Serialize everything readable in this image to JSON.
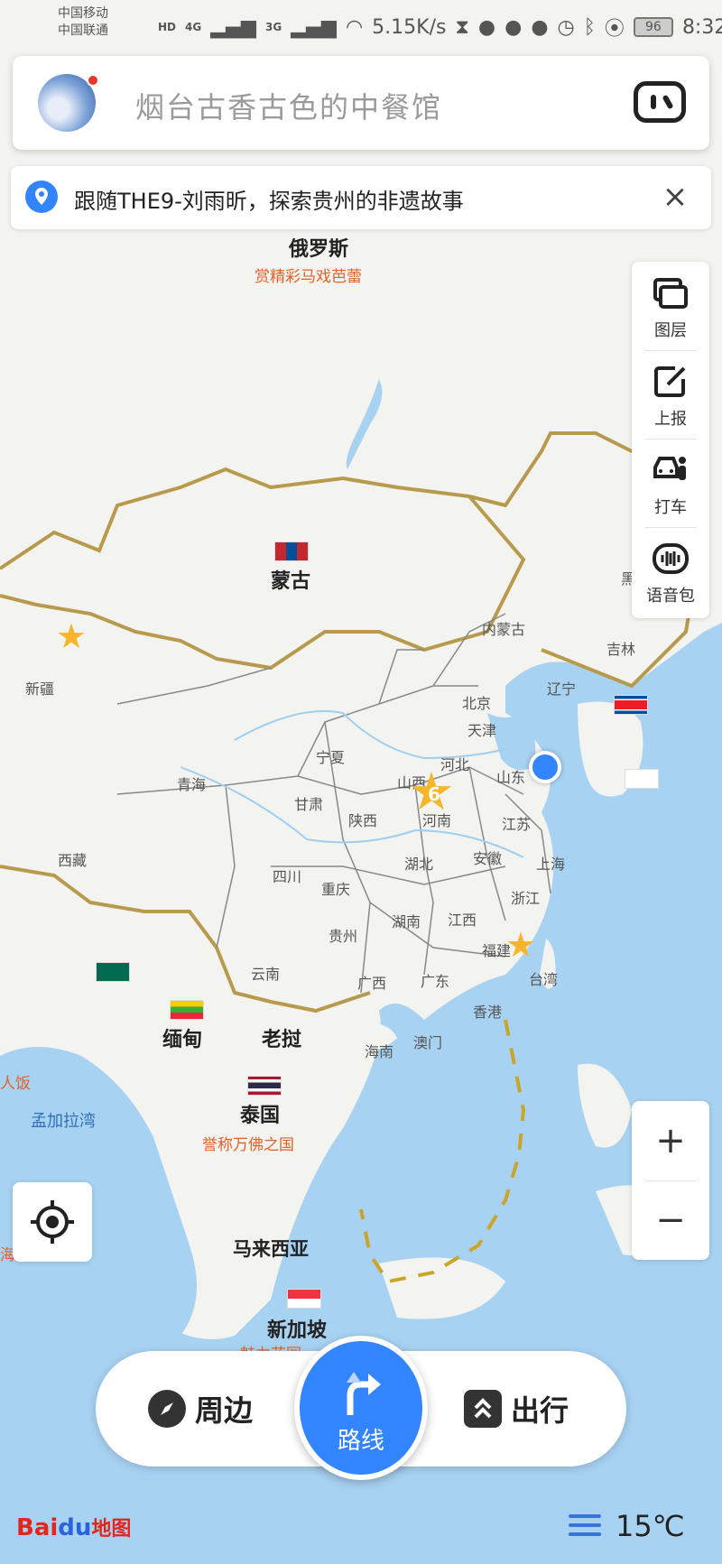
{
  "status_bar": {
    "carrier_1": "中国移动",
    "carrier_2": "中国联通",
    "hd": "HD",
    "net_4g": "4G",
    "net_3g": "3G",
    "speed": "5.15K/s",
    "battery": "96",
    "time": "8:32"
  },
  "search": {
    "placeholder": "烟台古香古色的中餐馆",
    "avatar_icon": "profile-avatar",
    "scan_icon": "ar-scan-icon"
  },
  "banner": {
    "text": "跟随THE9-刘雨昕，探索贵州的非遗故事",
    "close_label": "×"
  },
  "tools": [
    {
      "label": "图层",
      "icon": "layers-icon"
    },
    {
      "label": "上报",
      "icon": "report-edit-icon"
    },
    {
      "label": "打车",
      "icon": "taxi-icon"
    },
    {
      "label": "语音包",
      "icon": "voice-pack-icon"
    }
  ],
  "zoom": {
    "in": "+",
    "out": "−"
  },
  "map": {
    "countries": {
      "russia": "俄罗斯",
      "mongolia": "蒙古",
      "myanmar": "缅甸",
      "laos": "老挝",
      "thailand": "泰国",
      "malaysia": "马来西亚",
      "singapore": "新加坡"
    },
    "promos": {
      "russia": "赏精彩马戏芭蕾",
      "thailand": "誉称万佛之国",
      "singapore": "魅力花园",
      "left_edge": "人饭",
      "left_edge_2": "海"
    },
    "sea": "孟加拉湾",
    "provinces": {
      "xinjiang": "新疆",
      "inner_mongolia": "内蒙古",
      "jilin": "吉林",
      "heilongjiang": "黑",
      "liaoning": "辽宁",
      "beijing": "北京",
      "tianjin": "天津",
      "hebei": "河北",
      "shanxi": "山西",
      "shandong": "山东",
      "ningxia": "宁夏",
      "qinghai": "青海",
      "gansu": "甘肃",
      "shaanxi": "陕西",
      "henan": "河南",
      "jiangsu": "江苏",
      "xizang": "西藏",
      "sichuan": "四川",
      "hubei": "湖北",
      "anhui": "安徽",
      "shanghai": "上海",
      "chongqing": "重庆",
      "zhejiang": "浙江",
      "guizhou": "贵州",
      "hunan": "湖南",
      "jiangxi": "江西",
      "fujian": "福建",
      "yunnan": "云南",
      "guangxi": "广西",
      "guangdong": "广东",
      "taiwan": "台湾",
      "hongkong": "香港",
      "hainan": "海南",
      "macau": "澳门"
    },
    "cluster_count": "6"
  },
  "bottom_bar": {
    "nearby": "周边",
    "route": "路线",
    "travel": "出行"
  },
  "footer": {
    "logo_bai": "Bai",
    "logo_du": "du",
    "logo_map": "地图",
    "temperature": "15℃"
  },
  "colors": {
    "accent": "#3385ff",
    "border": "#b89a4e",
    "sea": "#a8d2f2",
    "star": "#f7b52b"
  }
}
